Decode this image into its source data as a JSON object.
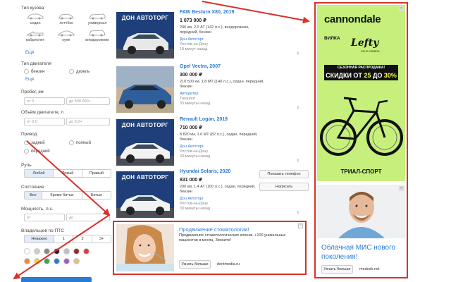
{
  "filters": {
    "body_label": "Тип кузова",
    "body_types": [
      "седан",
      "хетчбэк",
      "универсал",
      "кабриолет",
      "купе",
      "внедорожник"
    ],
    "more_link": "Ещё",
    "engine_label": "Тип двигателя",
    "engine_options": [
      "бензин",
      "дизель"
    ],
    "mileage_label": "Пробег, км",
    "mileage_from": "от 0",
    "mileage_to": "до 500 000+",
    "volume_label": "Объём двигателя, л",
    "volume_from": "от 0,0",
    "volume_to": "до 6,0+",
    "drive_label": "Привод",
    "drive_options": [
      "задний",
      "полный",
      "передний"
    ],
    "steering_label": "Руль",
    "steering_options": [
      "Любой",
      "Левый",
      "Правый"
    ],
    "condition_label": "Состояние",
    "condition_options": [
      "Все",
      "Кроме битых",
      "Битые"
    ],
    "power_label": "Мощность, л.с.",
    "power_from": "от",
    "power_to": "до",
    "owners_label": "Владельцев по ПТС",
    "owners_options": [
      "Неважно",
      "1",
      "2",
      "3+"
    ],
    "swatch_colors": [
      "#ffffff",
      "#cccccc",
      "#888888",
      "#222222",
      "#c0c0c0",
      "#8b2e2e",
      "#e23b3b",
      "#f28c28",
      "#f5d02b",
      "#2fa84f",
      "#2a7bd3",
      "#a259c4",
      "#d9c08c"
    ]
  },
  "listings": [
    {
      "title": "FAW Besturn X80, 2019",
      "price": "1 073 000 ₽",
      "spec": "246 км, 2.0 AT (142 л.с.), внедорожник, передний, бензин",
      "seller": "Дон Автоторг",
      "city": "Ростов-на-Дону",
      "time": "18 минут назад",
      "brand_overlay": "ДОН АВТОТОРГ",
      "car_color": "#e8e8e8"
    },
    {
      "title": "Opel Vectra, 2007",
      "price": "300 000 ₽",
      "spec": "210 500 км, 1.8 MT (140 л.с.), седан, передний, бензин",
      "seller": "Автодетер",
      "city": "Таганрог",
      "time": "33 минуты назад",
      "brand_overlay": "",
      "car_color": "#2f5f9a"
    },
    {
      "title": "Renault Logan, 2019",
      "price": "710 000 ₽",
      "spec": "8 820 км, 1.6 MT (82 л.с.), седан, передний, бензин",
      "seller": "Дон Автоторг",
      "city": "Ростов-на-Дону",
      "time": "33 минуты назад",
      "brand_overlay": "ДОН АВТОТОРГ",
      "car_color": "#f2f2f2"
    },
    {
      "title": "Hyundai Solaris, 2020",
      "price": "831 000 ₽",
      "spec": "200 км, 1.4 AT (100 л.с.), седан, передний, бензин",
      "seller": "Дон Автоторг",
      "city": "Ростов-на-Дону",
      "time": "33 минуты назад",
      "brand_overlay": "ДОН АВТОТОРГ",
      "car_color": "#f2f2f2"
    }
  ],
  "listing_actions": {
    "show_phone": "Показать телефон",
    "write": "Написать"
  },
  "dental_ad": {
    "title": "Продвижение стоматологии!",
    "text": "Продвижение стоматологических клиник. +100 уникальных пациентов в месяц. Звоните!",
    "button": "Узнать больше",
    "site": "dentmedia.ru"
  },
  "bike_ad": {
    "brand": "cannondale",
    "product": "ВИЛКА",
    "model": "Lefty",
    "model_sub": "OCHO CARBON",
    "badge": "СЕЗОННАЯ РАСПРОДАЖА!",
    "sale_prefix": "СКИДКИ ОТ",
    "sale_from": "25",
    "sale_mid": "ДО",
    "sale_to": "30%",
    "shop": "ТРИАЛ-СПОРТ"
  },
  "mis_ad": {
    "title": "Облачная МИС нового поколения!",
    "button": "Узнать больше",
    "site": "medesk.net"
  },
  "colors": {
    "accent": "#2a7bd3",
    "ad_border": "#d9312b",
    "bike_bg": "#c6ef7c",
    "dealer_blue": "#1e3f7a"
  }
}
